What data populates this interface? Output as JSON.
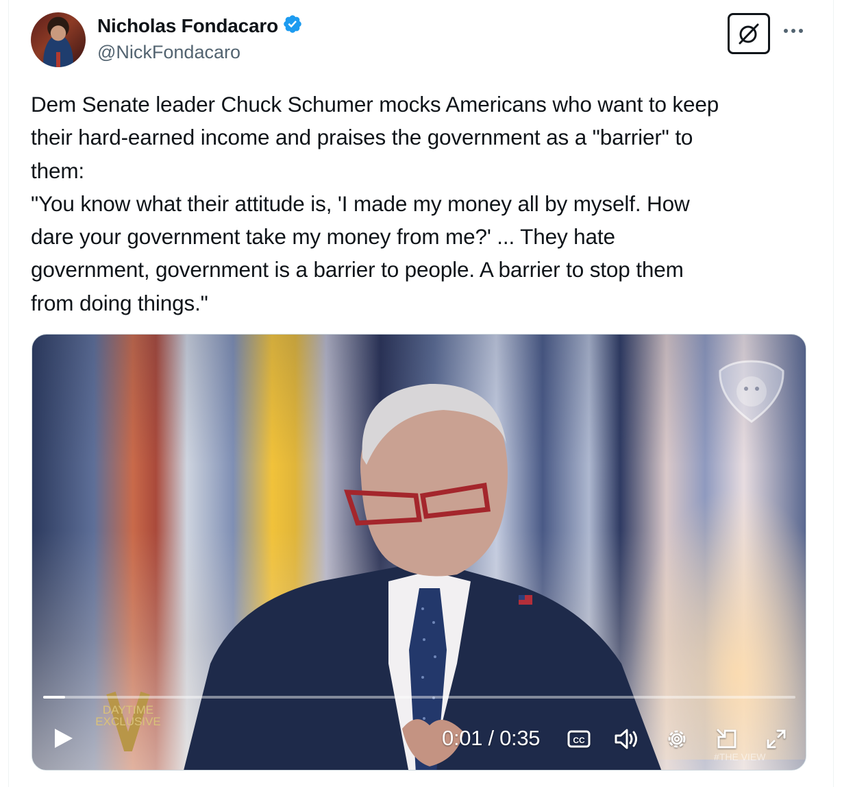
{
  "author": {
    "display_name": "Nicholas Fondacaro",
    "handle": "@NickFondacaro",
    "verified": true
  },
  "tweet": {
    "lines": [
      "Dem Senate leader Chuck Schumer mocks Americans who want to keep",
      "their hard-earned income and praises the government as a \"barrier\" to",
      "them:",
      "\"You know what their attitude is, 'I made my money all by myself. How",
      "dare your government take my money from me?' ... They hate",
      "government, government is a barrier to people. A barrier to stop them",
      "from doing things.\""
    ]
  },
  "video": {
    "current_time": "0:01",
    "duration": "0:35",
    "time_display": "0:01 / 0:35",
    "progress_fraction": 0.029,
    "overlay_text": [
      "DAYTIME",
      "EXCLUSIVE"
    ],
    "corner_text": "#THE VIEW"
  },
  "icons": {
    "verified": "verified-badge-icon",
    "grok": "grok-icon",
    "more": "more-icon",
    "play": "play-icon",
    "captions": "captions-icon",
    "volume": "volume-icon",
    "settings": "settings-icon",
    "pip": "picture-in-picture-icon",
    "fullscreen": "fullscreen-icon"
  },
  "colors": {
    "text_primary": "#0f1419",
    "text_secondary": "#536471",
    "verified_blue": "#1d9bf0"
  }
}
